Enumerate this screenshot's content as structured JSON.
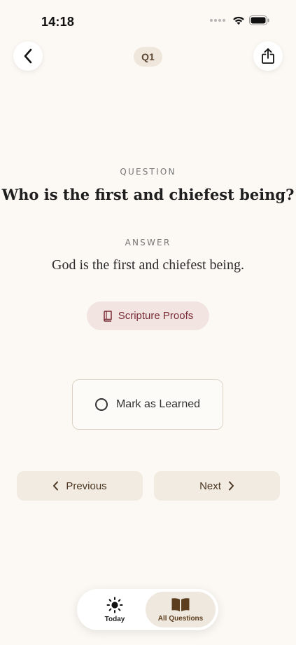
{
  "status_bar": {
    "time": "14:18"
  },
  "header": {
    "badge": "Q1",
    "back_icon": "chevron-left-icon",
    "share_icon": "share-icon"
  },
  "content": {
    "question_label": "QUESTION",
    "question": "Who is the first and chiefest being?",
    "answer_label": "ANSWER",
    "answer": "God is the first and chiefest being.",
    "proofs_label": "Scripture Proofs",
    "mark_learned_label": "Mark as Learned"
  },
  "pager": {
    "previous_label": "Previous",
    "next_label": "Next"
  },
  "tabs": [
    {
      "label": "Today",
      "icon": "sun-icon",
      "selected": false
    },
    {
      "label": "All Questions",
      "icon": "book-open-icon",
      "selected": true
    }
  ],
  "colors": {
    "background": "#fcf9f4",
    "accent_brown": "#5c3d1e",
    "proofs_text": "#7a2c36",
    "proofs_bg": "#f1e4e1"
  }
}
